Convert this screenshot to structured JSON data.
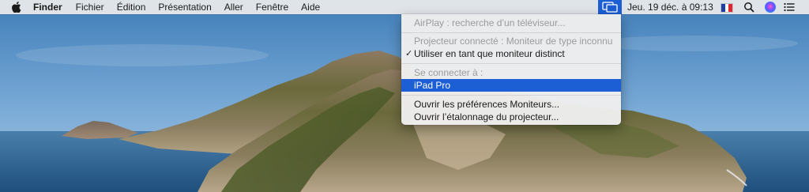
{
  "menubar": {
    "apple_icon": "apple-icon",
    "app_name": "Finder",
    "items": [
      "Fichier",
      "Édition",
      "Présentation",
      "Aller",
      "Fenêtre",
      "Aide"
    ],
    "clock": "Jeu. 19 déc. à  09:13",
    "status_icons": [
      "airplay-icon",
      "france-flag-icon",
      "spotlight-icon",
      "siri-icon",
      "notification-center-icon"
    ]
  },
  "dropdown": {
    "airplay_search": "AirPlay : recherche d’un téléviseur...",
    "projector_connected": "Projecteur connecté : Moniteur de type inconnu",
    "use_separate_display": "Utiliser en tant que moniteur distinct",
    "use_separate_checked": "✓",
    "connect_to": "Se connecter à :",
    "ipad": "iPad Pro",
    "open_display_prefs": "Ouvrir les préférences Moniteurs...",
    "open_calibration": "Ouvrir l’étalonnage du projecteur..."
  },
  "colors": {
    "accent": "#1c5fd4",
    "sky": "#5b93c6",
    "sea": "#2b5f8d"
  }
}
